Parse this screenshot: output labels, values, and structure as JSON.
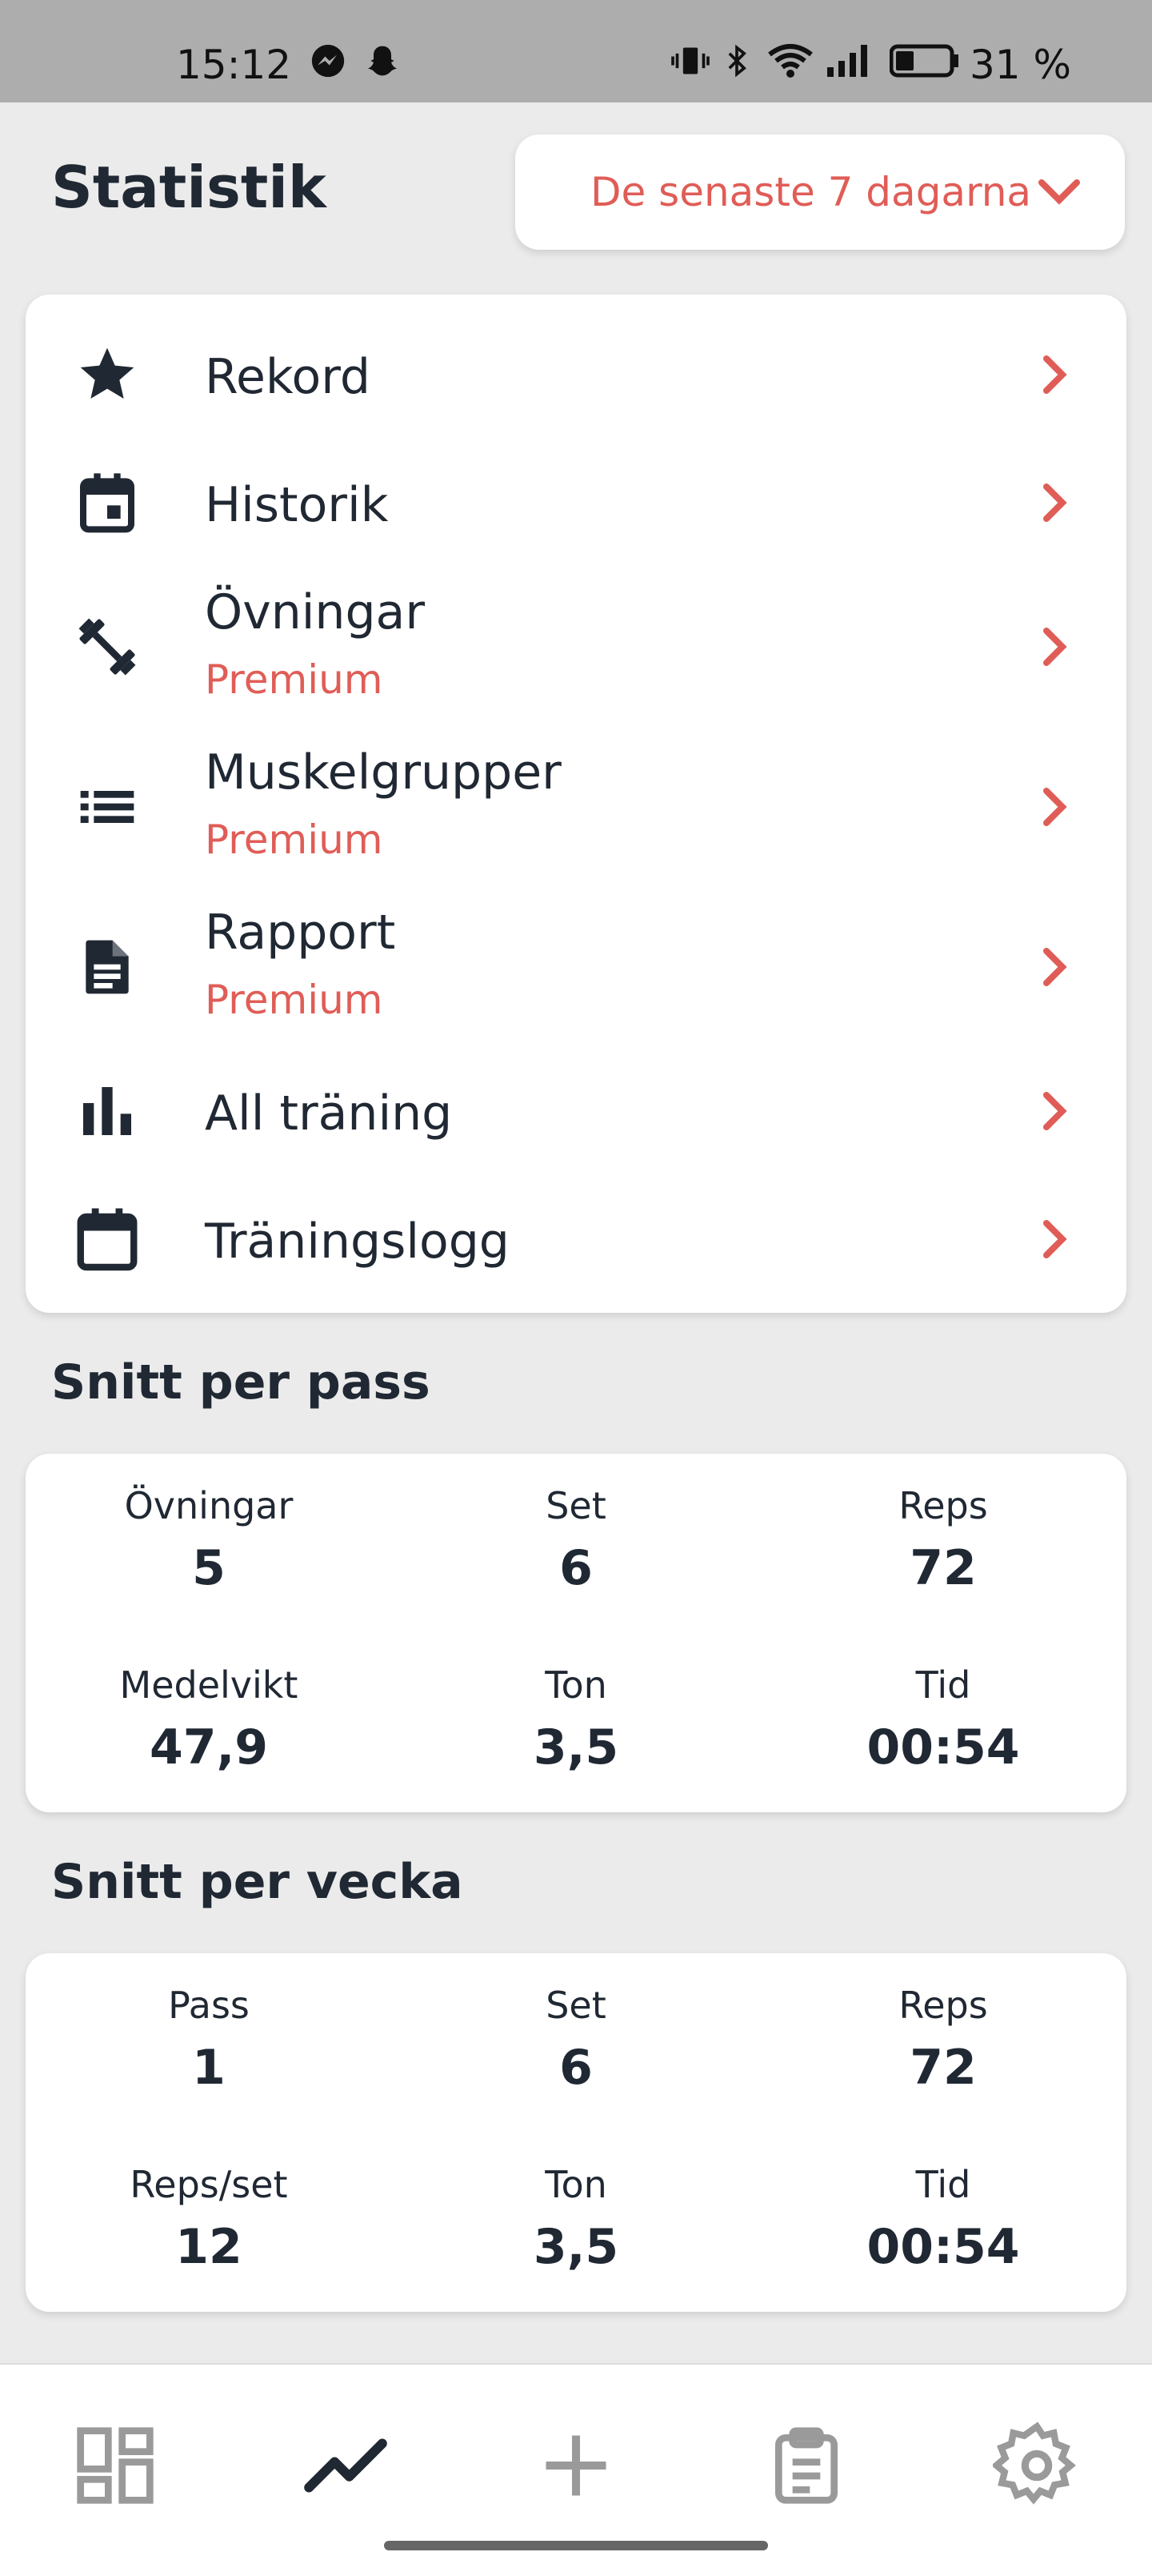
{
  "status_bar": {
    "time": "15:12",
    "battery": "31 %"
  },
  "header": {
    "title": "Statistik",
    "range_label": "De senaste 7 dagarna"
  },
  "menu": [
    {
      "label": "Rekord",
      "sub": ""
    },
    {
      "label": "Historik",
      "sub": ""
    },
    {
      "label": "Övningar",
      "sub": "Premium"
    },
    {
      "label": "Muskelgrupper",
      "sub": "Premium"
    },
    {
      "label": "Rapport",
      "sub": "Premium"
    },
    {
      "label": "All träning",
      "sub": ""
    },
    {
      "label": "Träningslogg",
      "sub": ""
    }
  ],
  "per_session": {
    "title": "Snitt per pass",
    "stats": [
      {
        "label": "Övningar",
        "value": "5"
      },
      {
        "label": "Set",
        "value": "6"
      },
      {
        "label": "Reps",
        "value": "72"
      },
      {
        "label": "Medelvikt",
        "value": "47,9"
      },
      {
        "label": "Ton",
        "value": "3,5"
      },
      {
        "label": "Tid",
        "value": "00:54"
      }
    ]
  },
  "per_week": {
    "title": "Snitt per vecka",
    "stats": [
      {
        "label": "Pass",
        "value": "1"
      },
      {
        "label": "Set",
        "value": "6"
      },
      {
        "label": "Reps",
        "value": "72"
      },
      {
        "label": "Reps/set",
        "value": "12"
      },
      {
        "label": "Ton",
        "value": "3,5"
      },
      {
        "label": "Tid",
        "value": "00:54"
      }
    ]
  },
  "colors": {
    "accent": "#e05d57",
    "text": "#202833",
    "background": "#ebebeb"
  }
}
